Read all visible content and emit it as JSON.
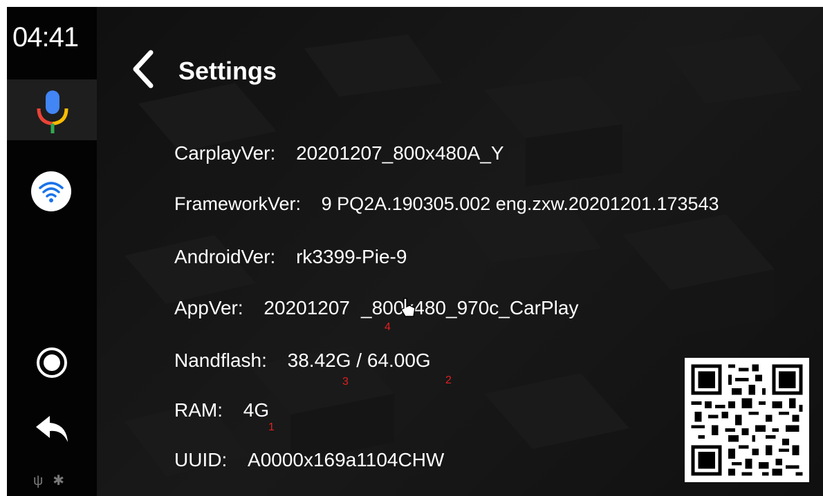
{
  "status": {
    "time": "04:41"
  },
  "header": {
    "title": "Settings"
  },
  "info": [
    {
      "label": "CarplayVer:",
      "value": "20201207_800x480A_Y"
    },
    {
      "label": "FrameworkVer:",
      "value": "9 PQ2A.190305.002 eng.zxw.20201201.173543"
    },
    {
      "label": "AndroidVer:",
      "value": "rk3399-Pie-9"
    },
    {
      "label": "AppVer:",
      "value": "20201207",
      "value_suffix": "_800x480_970c_CarPlay"
    },
    {
      "label": "Nandflash:",
      "value": "38.42G / 64.00G"
    },
    {
      "label": "RAM:",
      "value": "4G"
    },
    {
      "label": "UUID:",
      "value": "A0000x169a1104CHW"
    }
  ],
  "annotations": {
    "a1": "1",
    "a2": "2",
    "a3": "3",
    "a4": "4"
  },
  "sidebar_icons": [
    "mic-icon",
    "wifi-icon",
    "home-circle-icon",
    "back-arrow-icon",
    "usb-icon",
    "bluetooth-icon"
  ],
  "colors": {
    "background": "#0b0b0b",
    "annotation": "#e02020",
    "wifi_accent": "#1a73e8"
  }
}
